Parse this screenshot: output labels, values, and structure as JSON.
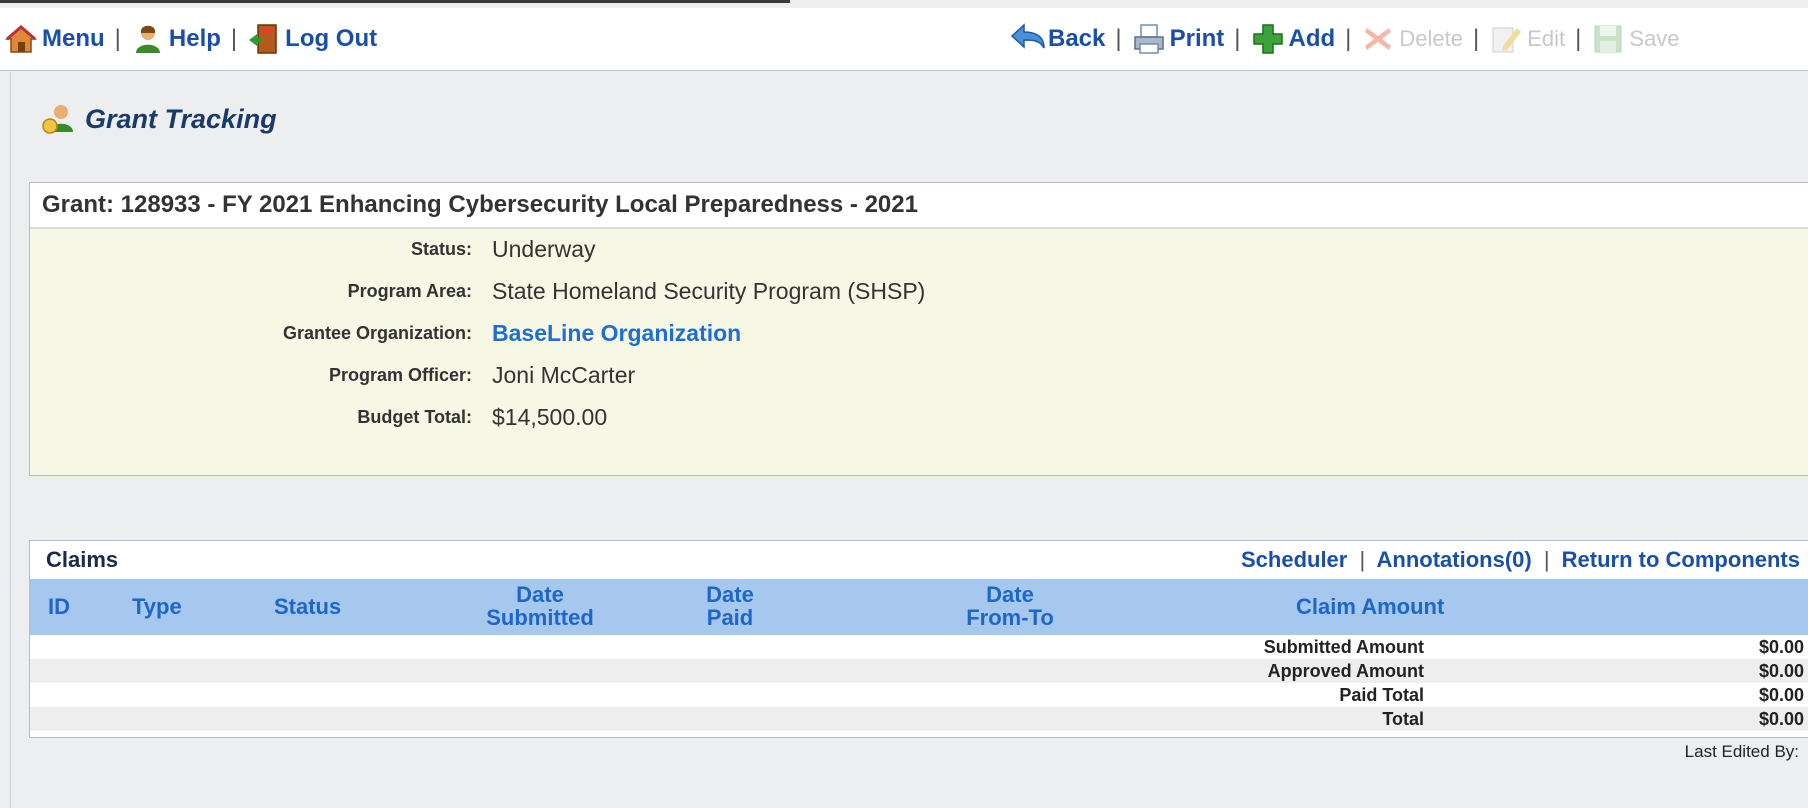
{
  "topnav": {
    "menu": "Menu",
    "help": "Help",
    "logout": "Log Out",
    "back": "Back",
    "print": "Print",
    "add": "Add",
    "delete": "Delete",
    "edit": "Edit",
    "save": "Save",
    "separator": "|"
  },
  "page_title": "Grant Tracking",
  "grant": {
    "header": "Grant: 128933 - FY 2021 Enhancing Cybersecurity Local Preparedness - 2021",
    "fields": [
      {
        "label": "Status:",
        "value": "Underway"
      },
      {
        "label": "Program Area:",
        "value": "State Homeland Security Program (SHSP)"
      },
      {
        "label": "Grantee Organization:",
        "value": "BaseLine Organization"
      },
      {
        "label": "Program Officer:",
        "value": "Joni McCarter"
      },
      {
        "label": "Budget Total:",
        "value": "$14,500.00"
      }
    ]
  },
  "claims": {
    "title": "Claims",
    "links": {
      "scheduler": "Scheduler",
      "annotations": "Annotations(0)",
      "return": "Return to Components"
    },
    "columns": {
      "id": "ID",
      "type": "Type",
      "status": "Status",
      "date_submitted_1": "Date",
      "date_submitted_2": "Submitted",
      "date_paid_1": "Date",
      "date_paid_2": "Paid",
      "date_fromto_1": "Date",
      "date_fromto_2": "From-To",
      "claim_amount": "Claim Amount"
    },
    "summary": [
      {
        "label": "Submitted Amount",
        "value": "$0.00"
      },
      {
        "label": "Approved Amount",
        "value": "$0.00"
      },
      {
        "label": "Paid Total",
        "value": "$0.00"
      },
      {
        "label": "Total",
        "value": "$0.00"
      }
    ]
  },
  "last_edited": "Last Edited By:",
  "colors": {
    "link": "#1a4fa8",
    "header_band": "#a6c8ee",
    "panel_bg": "#f7f7e6",
    "annotation_arrow": "#e00000"
  }
}
